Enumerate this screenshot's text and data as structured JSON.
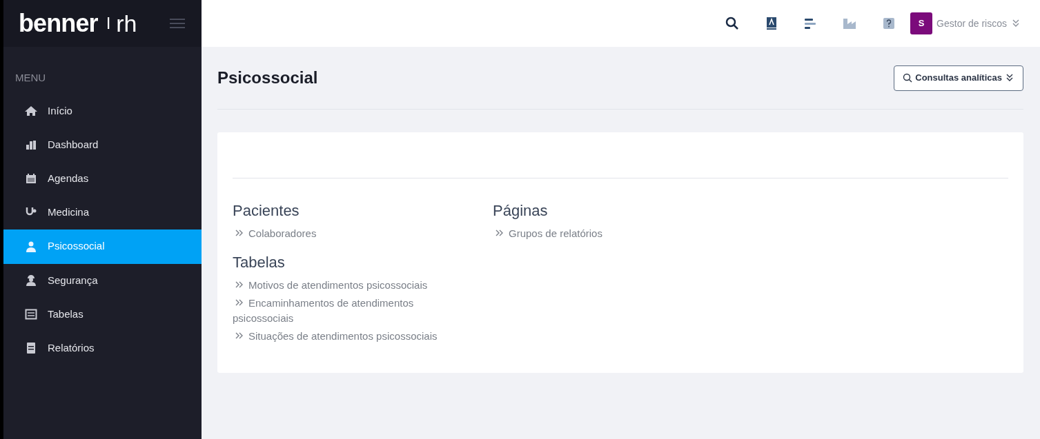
{
  "logo": {
    "brand": "benner",
    "separator": "I",
    "product": "rh"
  },
  "sidebar": {
    "heading": "MENU",
    "items": [
      {
        "label": "Início",
        "kind": "home",
        "selected": false
      },
      {
        "label": "Dashboard",
        "kind": "chart",
        "selected": false
      },
      {
        "label": "Agendas",
        "kind": "calendar",
        "selected": false
      },
      {
        "label": "Medicina",
        "kind": "stethoscope",
        "selected": false
      },
      {
        "label": "Psicossocial",
        "kind": "doctor",
        "selected": true
      },
      {
        "label": "Segurança",
        "kind": "worker",
        "selected": false
      },
      {
        "label": "Tabelas",
        "kind": "table",
        "selected": false
      },
      {
        "label": "Relatórios",
        "kind": "report",
        "selected": false
      }
    ]
  },
  "topbar": {
    "avatar": "S",
    "user": "Gestor de riscos"
  },
  "page": {
    "title": "Psicossocial",
    "action": "Consultas analíticas",
    "columns": [
      {
        "sections": [
          {
            "title": "Pacientes",
            "links": [
              "Colaboradores"
            ]
          },
          {
            "title": "Tabelas",
            "links": [
              "Motivos de atendimentos psicossociais",
              "Encaminhamentos de atendimentos psicossociais",
              "Situações de atendimentos psicossociais"
            ]
          }
        ]
      },
      {
        "sections": [
          {
            "title": "Páginas",
            "links": [
              "Grupos de relatórios"
            ]
          }
        ]
      }
    ]
  }
}
